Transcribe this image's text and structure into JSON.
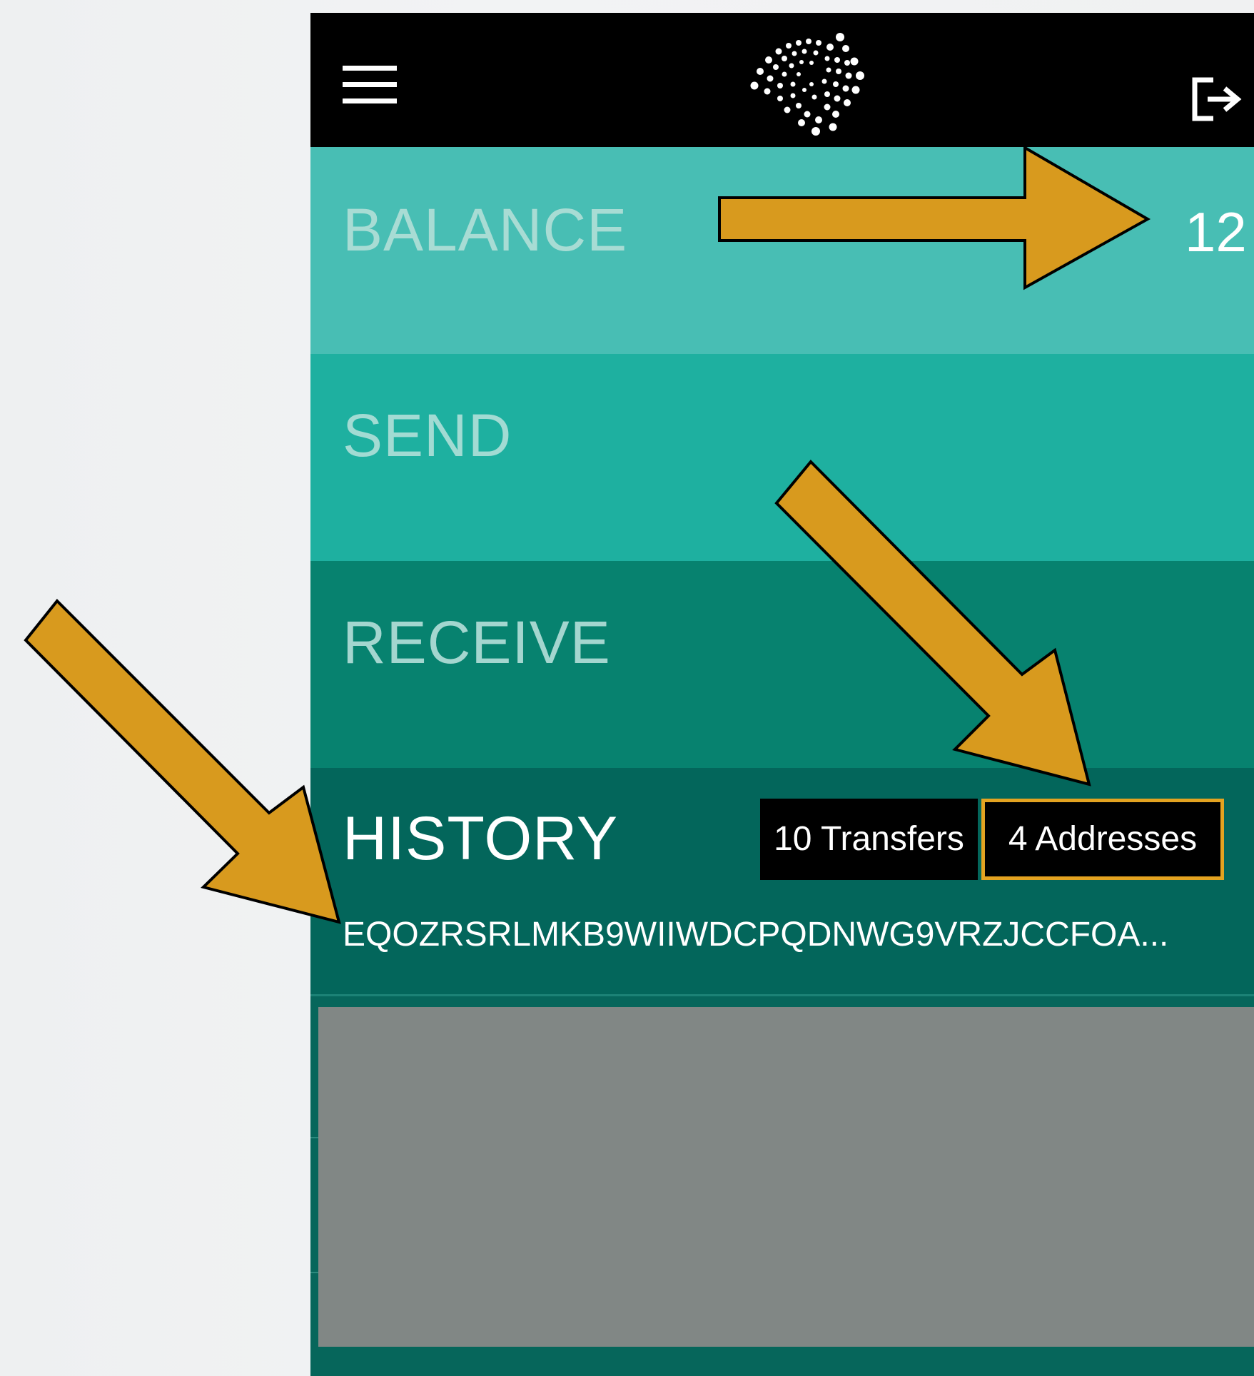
{
  "header": {
    "menu_icon": "hamburger-menu-icon",
    "logo_icon": "iota-logo-icon",
    "logout_icon": "logout-icon"
  },
  "sections": {
    "balance": {
      "label": "BALANCE",
      "value": "12"
    },
    "send": {
      "label": "SEND"
    },
    "receive": {
      "label": "RECEIVE"
    },
    "history": {
      "label": "HISTORY",
      "transfers_button": "10 Transfers",
      "addresses_button": "4 Addresses",
      "address": "EQOZRSRLMKB9WIIWDCPQDNWG9VRZJCCFOA..."
    }
  },
  "colors": {
    "topbar": "#000000",
    "balance_bg": "#48beb4",
    "send_bg": "#1eb0a0",
    "receive_bg": "#07826f",
    "history_bg": "#03665b",
    "highlight_border": "#e3a321",
    "annotation_arrow": "#d89a1e",
    "placeholder_panel": "#818785"
  }
}
